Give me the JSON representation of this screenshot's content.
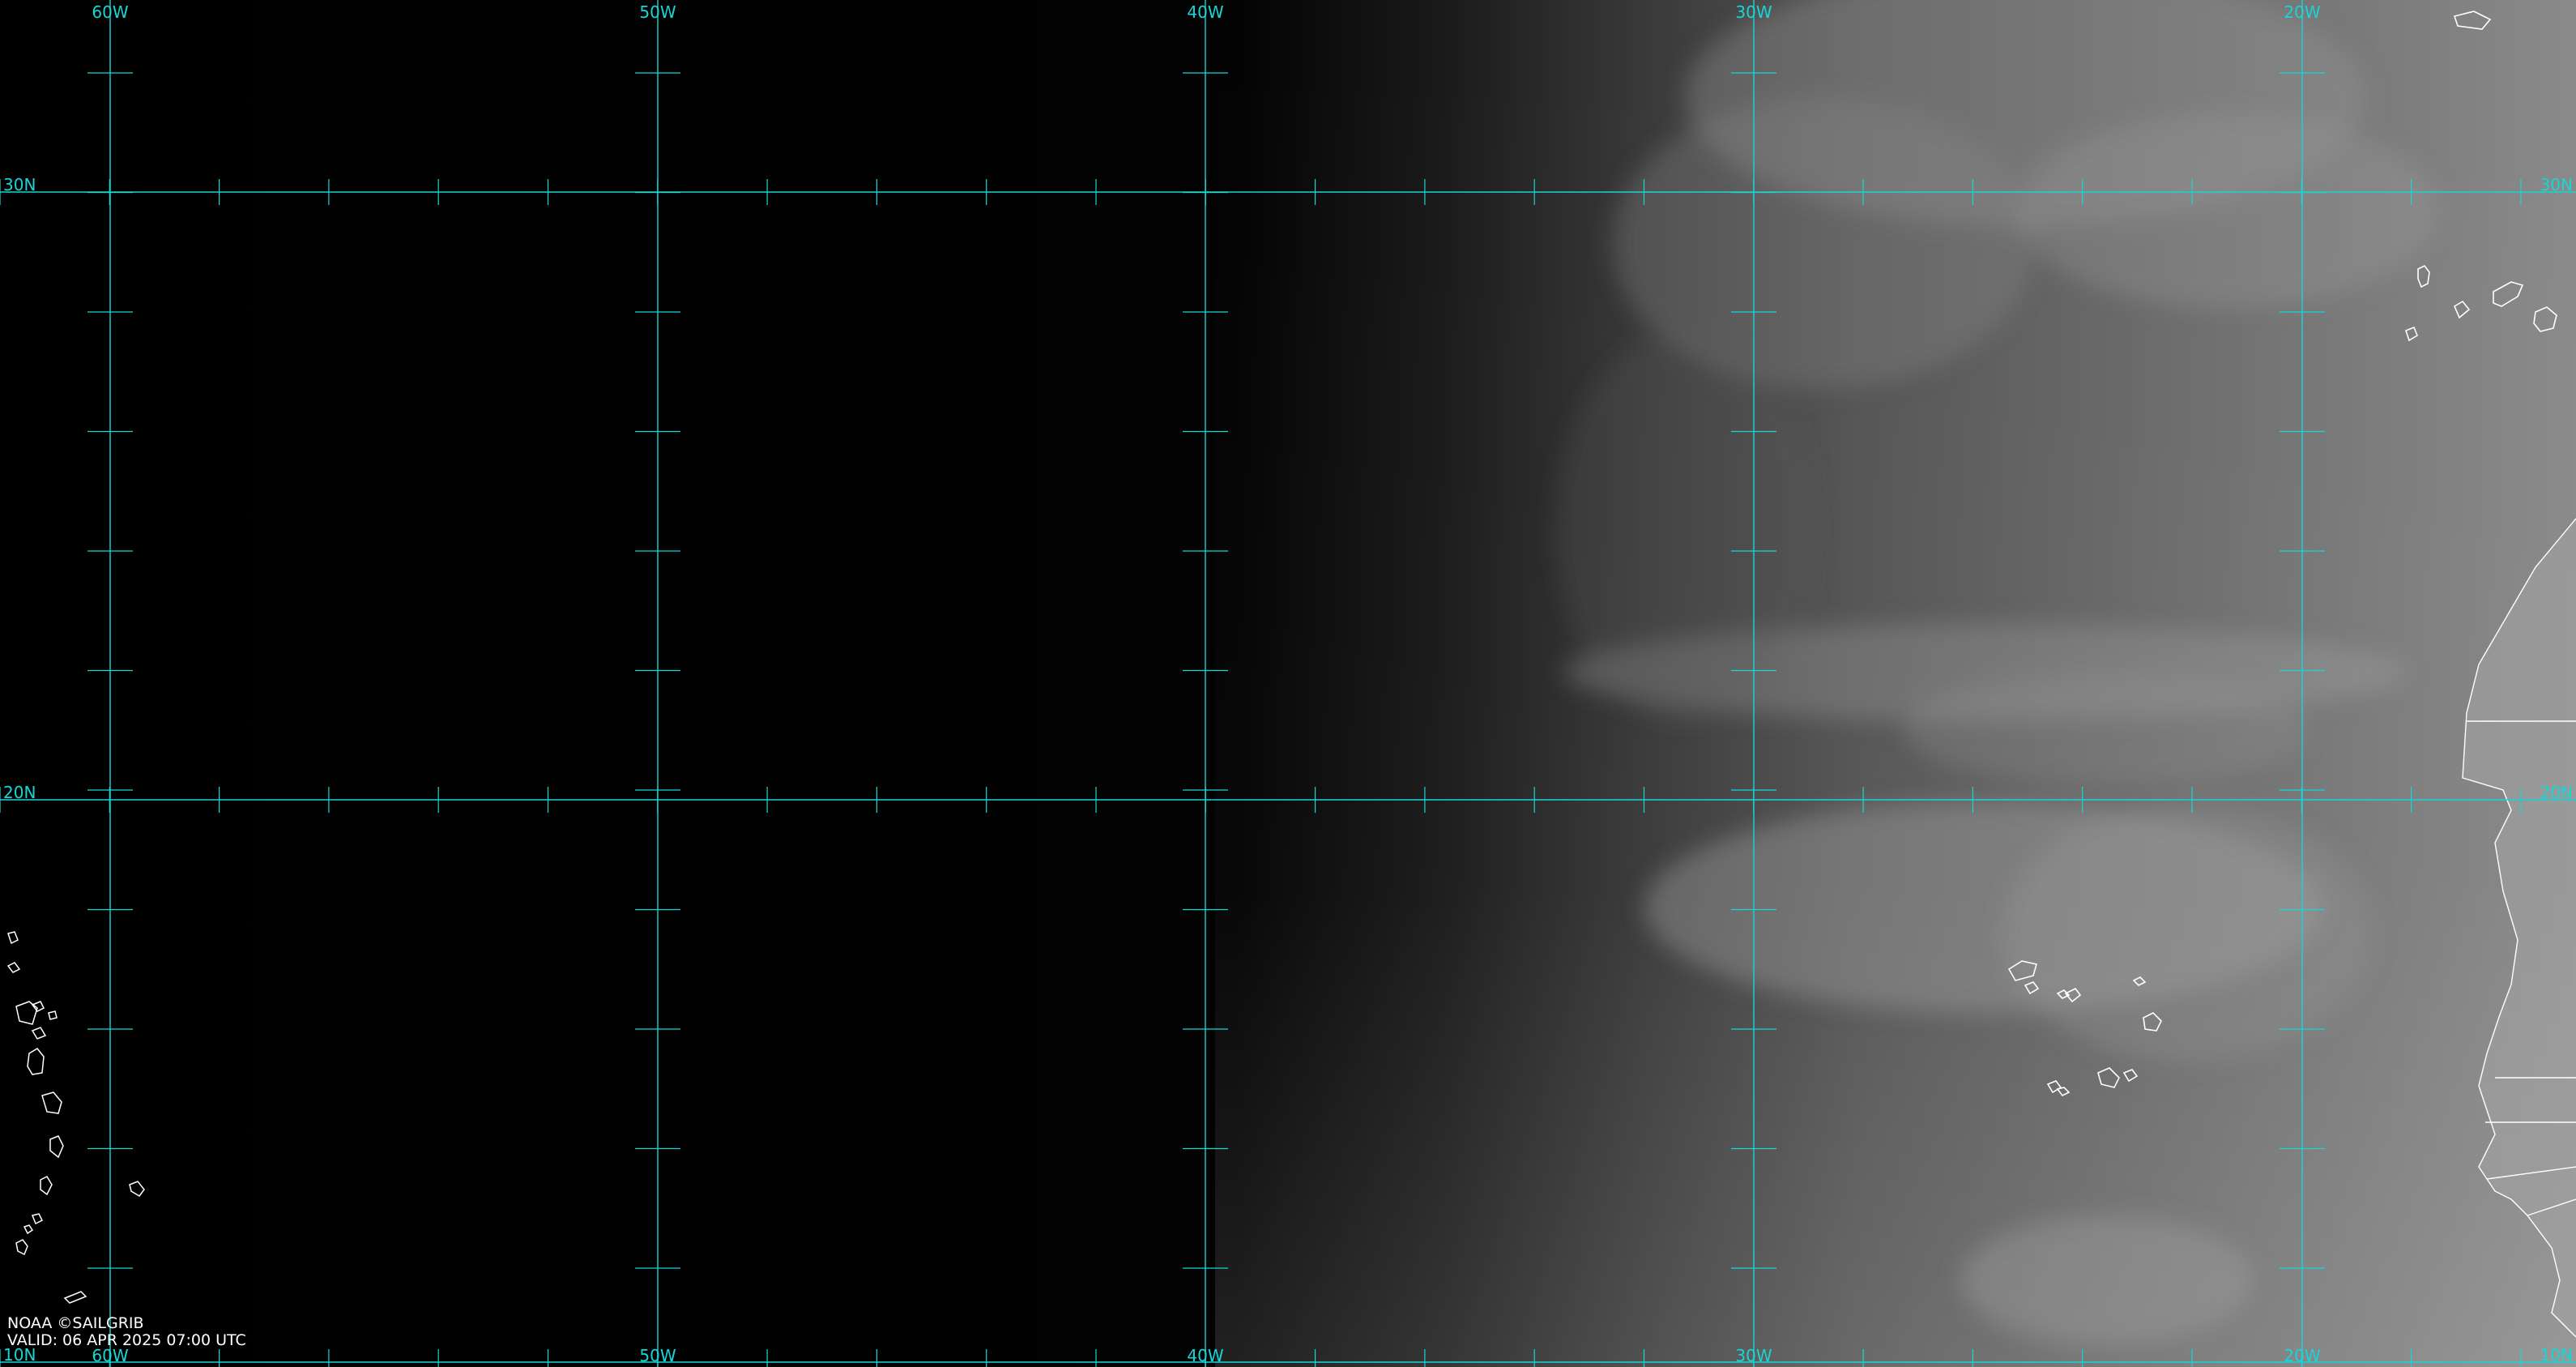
{
  "map": {
    "colors": {
      "grid": "#17d6d6",
      "coast": "#ffffff",
      "background": "#000000",
      "land": "#7e7e7e"
    },
    "longitude_labels": [
      "60W",
      "50W",
      "40W",
      "30W",
      "20W"
    ],
    "latitude_labels": [
      "30N",
      "20N",
      "10N"
    ]
  },
  "attribution": {
    "credit": "NOAA ©SAILGRIB",
    "valid": "VALID: 06 APR 2025 07:00 UTC"
  }
}
